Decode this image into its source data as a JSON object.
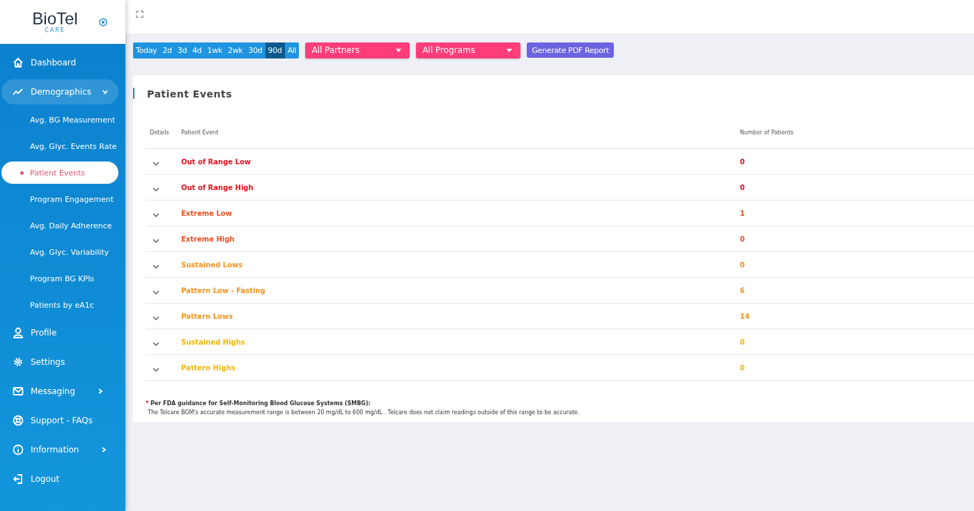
{
  "logo": {
    "name": "BioTel",
    "sub": "CARE"
  },
  "sidebar": {
    "items": [
      {
        "label": "Dashboard",
        "selected": false
      },
      {
        "label": "Demographics",
        "selected": true,
        "expanded": true,
        "children": [
          {
            "label": "Avg. BG Measurement",
            "selected": false
          },
          {
            "label": "Avg. Glyc. Events Rate",
            "selected": false
          },
          {
            "label": "Patient Events",
            "selected": true
          },
          {
            "label": "Program Engagement",
            "selected": false
          },
          {
            "label": "Avg. Daily Adherence",
            "selected": false
          },
          {
            "label": "Avg. Glyc. Variability",
            "selected": false
          },
          {
            "label": "Program BG KPIs",
            "selected": false
          },
          {
            "label": "Patients by eA1c",
            "selected": false
          }
        ]
      },
      {
        "label": "Profile",
        "selected": false
      },
      {
        "label": "Settings",
        "selected": false
      },
      {
        "label": "Messaging",
        "selected": false,
        "expanded": false
      },
      {
        "label": "Support - FAQs",
        "selected": false
      },
      {
        "label": "Information",
        "selected": false,
        "expanded": false
      },
      {
        "label": "Logout",
        "selected": false
      }
    ]
  },
  "toolbar": {
    "ranges": [
      {
        "label": "Today",
        "selected": false
      },
      {
        "label": "2d",
        "selected": false
      },
      {
        "label": "3d",
        "selected": false
      },
      {
        "label": "4d",
        "selected": false
      },
      {
        "label": "1wk",
        "selected": false
      },
      {
        "label": "2wk",
        "selected": false
      },
      {
        "label": "30d",
        "selected": false
      },
      {
        "label": "90d",
        "selected": true
      },
      {
        "label": "All",
        "selected": false
      }
    ],
    "partners": "All Partners",
    "programs": "All Programs",
    "report_button": "Generate PDF Report"
  },
  "card": {
    "title": "Patient Events",
    "table": {
      "columns": [
        "Details",
        "Patient Event",
        "Number of Patients"
      ],
      "rows": [
        {
          "event": "Out of Range Low",
          "count": "0",
          "color": "#e8101e",
          "expanded": false
        },
        {
          "event": "Out of Range High",
          "count": "0",
          "color": "#e8101e",
          "expanded": false
        },
        {
          "event": "Extreme Low",
          "count": "1",
          "color": "#f04e23",
          "expanded": false
        },
        {
          "event": "Extreme High",
          "count": "0",
          "color": "#f04e23",
          "expanded": false
        },
        {
          "event": "Sustained Lows",
          "count": "0",
          "color": "#f7931e",
          "expanded": false
        },
        {
          "event": "Pattern Low - Fasting",
          "count": "6",
          "color": "#f7931e",
          "expanded": false
        },
        {
          "event": "Pattern Lows",
          "count": "14",
          "color": "#f7931e",
          "expanded": false
        },
        {
          "event": "Sustained Highs",
          "count": "0",
          "color": "#f2b705",
          "expanded": false
        },
        {
          "event": "Pattern Highs",
          "count": "0",
          "color": "#f2b705",
          "expanded": false
        }
      ]
    },
    "footnote": {
      "mark": "*",
      "heading": "Per FDA guidance for Self-Monitoring Blood Glucose Systems (SMBG):",
      "text": "The Telcare BGM's accurate measurement range is between 20 mg/dL to 600 mg/dL . Telcare does not claim readings outside of this range to be accurate."
    }
  }
}
